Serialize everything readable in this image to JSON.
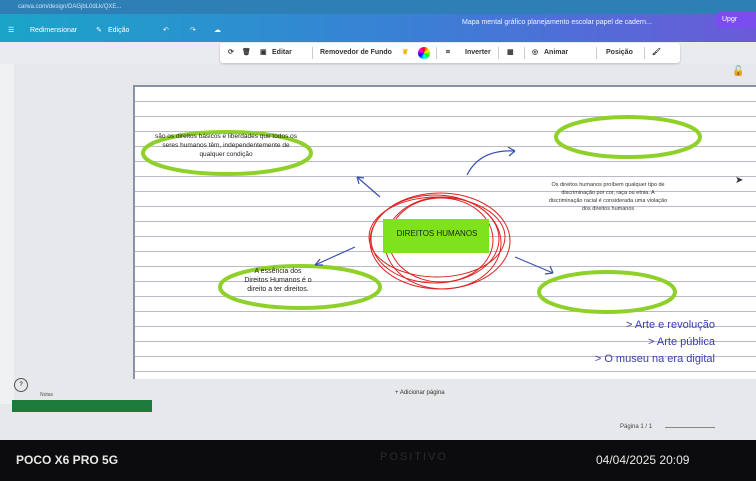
{
  "browser": {
    "url": "canva.com/design/DAGjbL0dLk/QXE..."
  },
  "menubar": {
    "resize": "Redimensionar",
    "edit": "Edição",
    "doc_title": "Mapa mental gráfico planejamento escolar papel de cadern...",
    "upgrade": "Upgr"
  },
  "toolbar": {
    "edit": "Editar",
    "bg_remover": "Removedor de Fundo",
    "flip": "Inverter",
    "animate": "Animar",
    "position": "Posição"
  },
  "mindmap": {
    "center": "DIREITOS HUMANOS",
    "top_left": "são os direitos básicos e liberdades que todos os seres humanos têm, independentemente de qualquer condição",
    "bottom_left": "A essência dos Direitos Humanos é o direito a ter direitos.",
    "right_note": "Os direitos humanos proíbem qualquer tipo de discriminação por cor, raça ou etnia. A discriminação racial é considerada uma violação dos direitos humanos",
    "list": [
      "> Arte e revolução",
      "> Arte pública",
      "> O museu na era digital"
    ]
  },
  "footer": {
    "add_page": "+ Adicionar página",
    "page_indicator": "Página 1 / 1",
    "notes": "Notas"
  },
  "photo": {
    "device": "POCO X6 PRO 5G",
    "datetime": "04/04/2025 20:09",
    "monitor_brand": "POSITIVO"
  }
}
